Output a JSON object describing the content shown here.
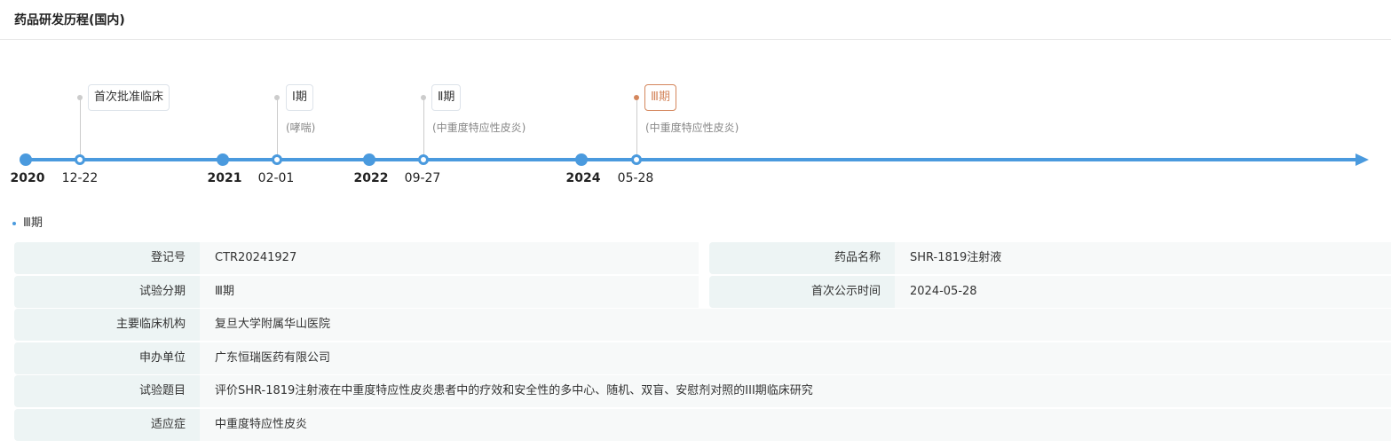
{
  "header": {
    "title": "药品研发历程(国内)"
  },
  "timeline": {
    "years": [
      "2020",
      "2021",
      "2022",
      "2024"
    ],
    "events": [
      {
        "date": "12-22",
        "label": "首次批准临床",
        "sub": ""
      },
      {
        "date": "02-01",
        "label": "Ⅰ期",
        "sub": "(哮喘)"
      },
      {
        "date": "09-27",
        "label": "Ⅱ期",
        "sub": "(中重度特应性皮炎)"
      },
      {
        "date": "05-28",
        "label": "Ⅲ期",
        "sub": "(中重度特应性皮炎)"
      }
    ],
    "colors": {
      "line": "#4a9ade",
      "active": "#d4865c"
    }
  },
  "section": {
    "title": "Ⅲ期"
  },
  "details": {
    "reg_no_label": "登记号",
    "reg_no": "CTR20241927",
    "drug_name_label": "药品名称",
    "drug_name": "SHR-1819注射液",
    "phase_label": "试验分期",
    "phase": "Ⅲ期",
    "first_pub_label": "首次公示时间",
    "first_pub": "2024-05-28",
    "institution_label": "主要临床机构",
    "institution": "复旦大学附属华山医院",
    "sponsor_label": "申办单位",
    "sponsor": "广东恒瑞医药有限公司",
    "title_label": "试验题目",
    "title": "评价SHR-1819注射液在中重度特应性皮炎患者中的疗效和安全性的多中心、随机、双盲、安慰剂对照的III期临床研究",
    "indication_label": "适应症",
    "indication": "中重度特应性皮炎"
  }
}
